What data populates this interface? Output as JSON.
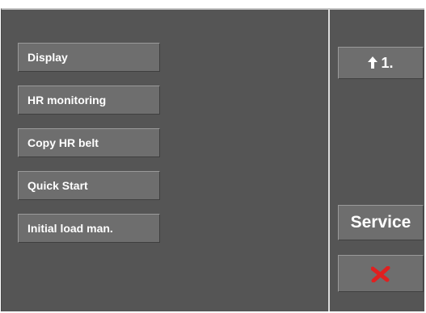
{
  "menu": {
    "items": [
      {
        "label": "Display"
      },
      {
        "label": "HR monitoring"
      },
      {
        "label": "Copy HR belt"
      },
      {
        "label": "Quick Start"
      },
      {
        "label": "Initial load man."
      }
    ]
  },
  "side": {
    "page_label": "1.",
    "page_icon": "arrow-up-icon",
    "service_label": "Service",
    "close_icon": "close-x-icon"
  },
  "colors": {
    "panel_bg": "#555555",
    "button_bg": "#6e6e6e",
    "divider": "#dcdcdc",
    "close_x": "#e02020",
    "text": "#ffffff"
  }
}
